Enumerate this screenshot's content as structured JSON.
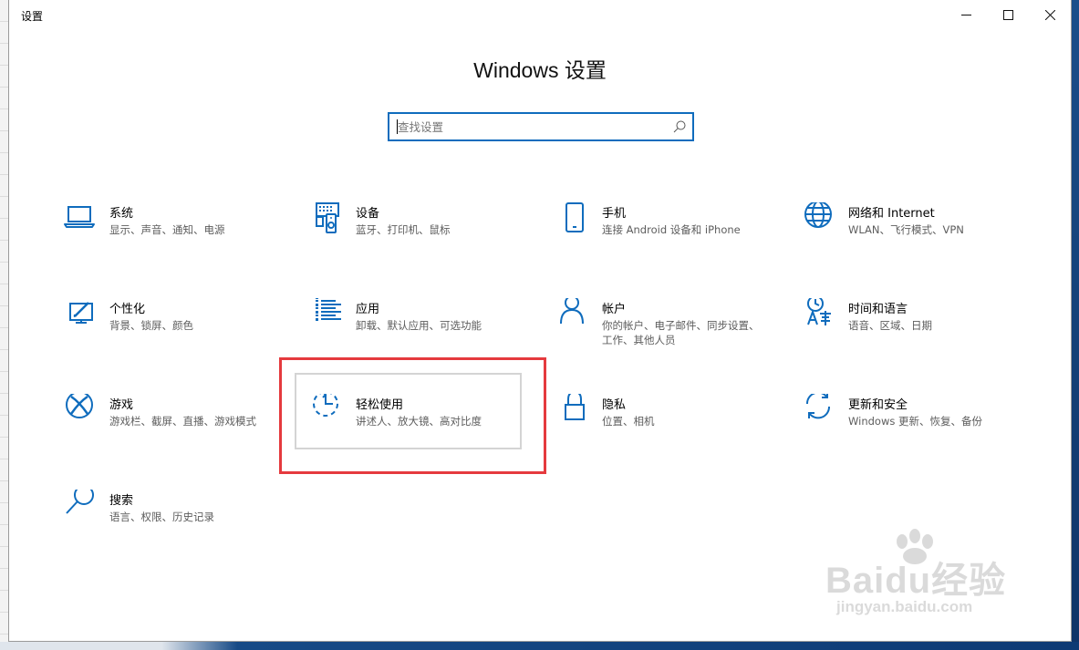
{
  "window": {
    "title": "设置",
    "controls": [
      "minimize-icon",
      "maximize-icon",
      "close-icon"
    ]
  },
  "page": {
    "title": "Windows 设置"
  },
  "search": {
    "placeholder": "查找设置",
    "value": "",
    "icon": "search-icon"
  },
  "categories": [
    {
      "label": "系统",
      "desc": "显示、声音、通知、电源",
      "icon": "laptop-icon"
    },
    {
      "label": "设备",
      "desc": "蓝牙、打印机、鼠标",
      "icon": "devices-icon"
    },
    {
      "label": "手机",
      "desc": "连接 Android 设备和 iPhone",
      "icon": "phone-icon"
    },
    {
      "label": "网络和 Internet",
      "desc": "WLAN、飞行模式、VPN",
      "icon": "globe-icon"
    },
    {
      "label": "个性化",
      "desc": "背景、锁屏、颜色",
      "icon": "personalization-icon"
    },
    {
      "label": "应用",
      "desc": "卸载、默认应用、可选功能",
      "icon": "apps-list-icon"
    },
    {
      "label": "帐户",
      "desc": "你的帐户、电子邮件、同步设置、工作、其他人员",
      "icon": "person-icon"
    },
    {
      "label": "时间和语言",
      "desc": "语音、区域、日期",
      "icon": "time-language-icon"
    },
    {
      "label": "游戏",
      "desc": "游戏栏、截屏、直播、游戏模式",
      "icon": "xbox-icon"
    },
    {
      "label": "轻松使用",
      "desc": "讲述人、放大镜、高对比度",
      "icon": "ease-of-access-icon"
    },
    {
      "label": "隐私",
      "desc": "位置、相机",
      "icon": "lock-icon"
    },
    {
      "label": "更新和安全",
      "desc": "Windows 更新、恢复、备份",
      "icon": "update-sync-icon"
    },
    {
      "label": "搜索",
      "desc": "语言、权限、历史记录",
      "icon": "magnifier-icon"
    }
  ],
  "watermark": {
    "brand": "Baidu经验",
    "url": "jingyan.baidu.com"
  },
  "colors": {
    "accent": "#0f6cbd",
    "highlight": "#e53a3e"
  }
}
